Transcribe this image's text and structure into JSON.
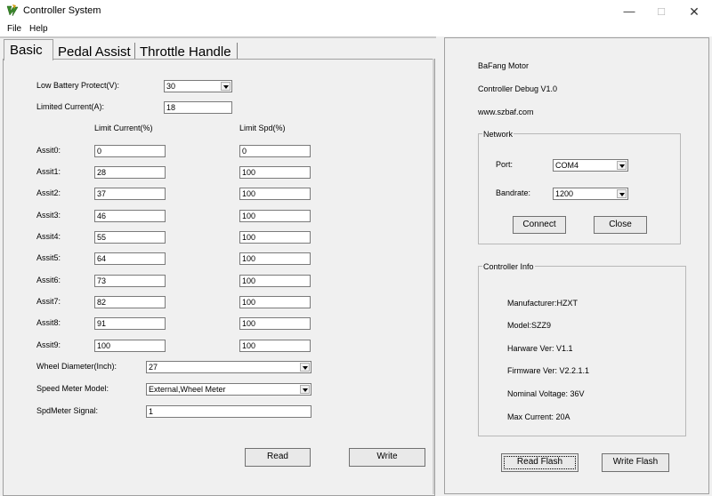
{
  "window": {
    "title": "Controller System"
  },
  "menu": [
    "File",
    "Help"
  ],
  "tabs": [
    "Basic",
    "Pedal Assist",
    "Throttle Handle"
  ],
  "basic": {
    "low_battery_label": "Low Battery Protect(V):",
    "low_battery_value": "30",
    "limited_current_label": "Limited Current(A):",
    "limited_current_value": "18",
    "col_limit_current": "Limit Current(%)",
    "col_limit_spd": "Limit Spd(%)",
    "assists": [
      {
        "label": "Assit0:",
        "current": "0",
        "spd": "0"
      },
      {
        "label": "Assit1:",
        "current": "28",
        "spd": "100"
      },
      {
        "label": "Assit2:",
        "current": "37",
        "spd": "100"
      },
      {
        "label": "Assit3:",
        "current": "46",
        "spd": "100"
      },
      {
        "label": "Assit4:",
        "current": "55",
        "spd": "100"
      },
      {
        "label": "Assit5:",
        "current": "64",
        "spd": "100"
      },
      {
        "label": "Assit6:",
        "current": "73",
        "spd": "100"
      },
      {
        "label": "Assit7:",
        "current": "82",
        "spd": "100"
      },
      {
        "label": "Assit8:",
        "current": "91",
        "spd": "100"
      },
      {
        "label": "Assit9:",
        "current": "100",
        "spd": "100"
      }
    ],
    "wheel_label": "Wheel Diameter(Inch):",
    "wheel_value": "27",
    "speed_model_label": "Speed Meter Model:",
    "speed_model_value": "External,Wheel Meter",
    "spd_signal_label": "SpdMeter Signal:",
    "spd_signal_value": "1",
    "read_label": "Read",
    "write_label": "Write"
  },
  "info": {
    "brand": "BaFang Motor",
    "debug": "Controller Debug V1.0",
    "website": "www.szbaf.com"
  },
  "network": {
    "title": "Network",
    "port_label": "Port:",
    "port_value": "COM4",
    "baud_label": "Bandrate:",
    "baud_value": "1200",
    "connect_label": "Connect",
    "close_label": "Close"
  },
  "controller_info": {
    "title": "Controller Info",
    "manufacturer": "Manufacturer:HZXT",
    "model": "Model:SZZ9",
    "hardware": "Harware Ver: V1.1",
    "firmware": "Firmware Ver: V2.2.1.1",
    "voltage": "Nominal Voltage: 36V",
    "max_current": "Max Current: 20A"
  },
  "flash": {
    "read_label": "Read Flash",
    "write_label": "Write Flash"
  }
}
